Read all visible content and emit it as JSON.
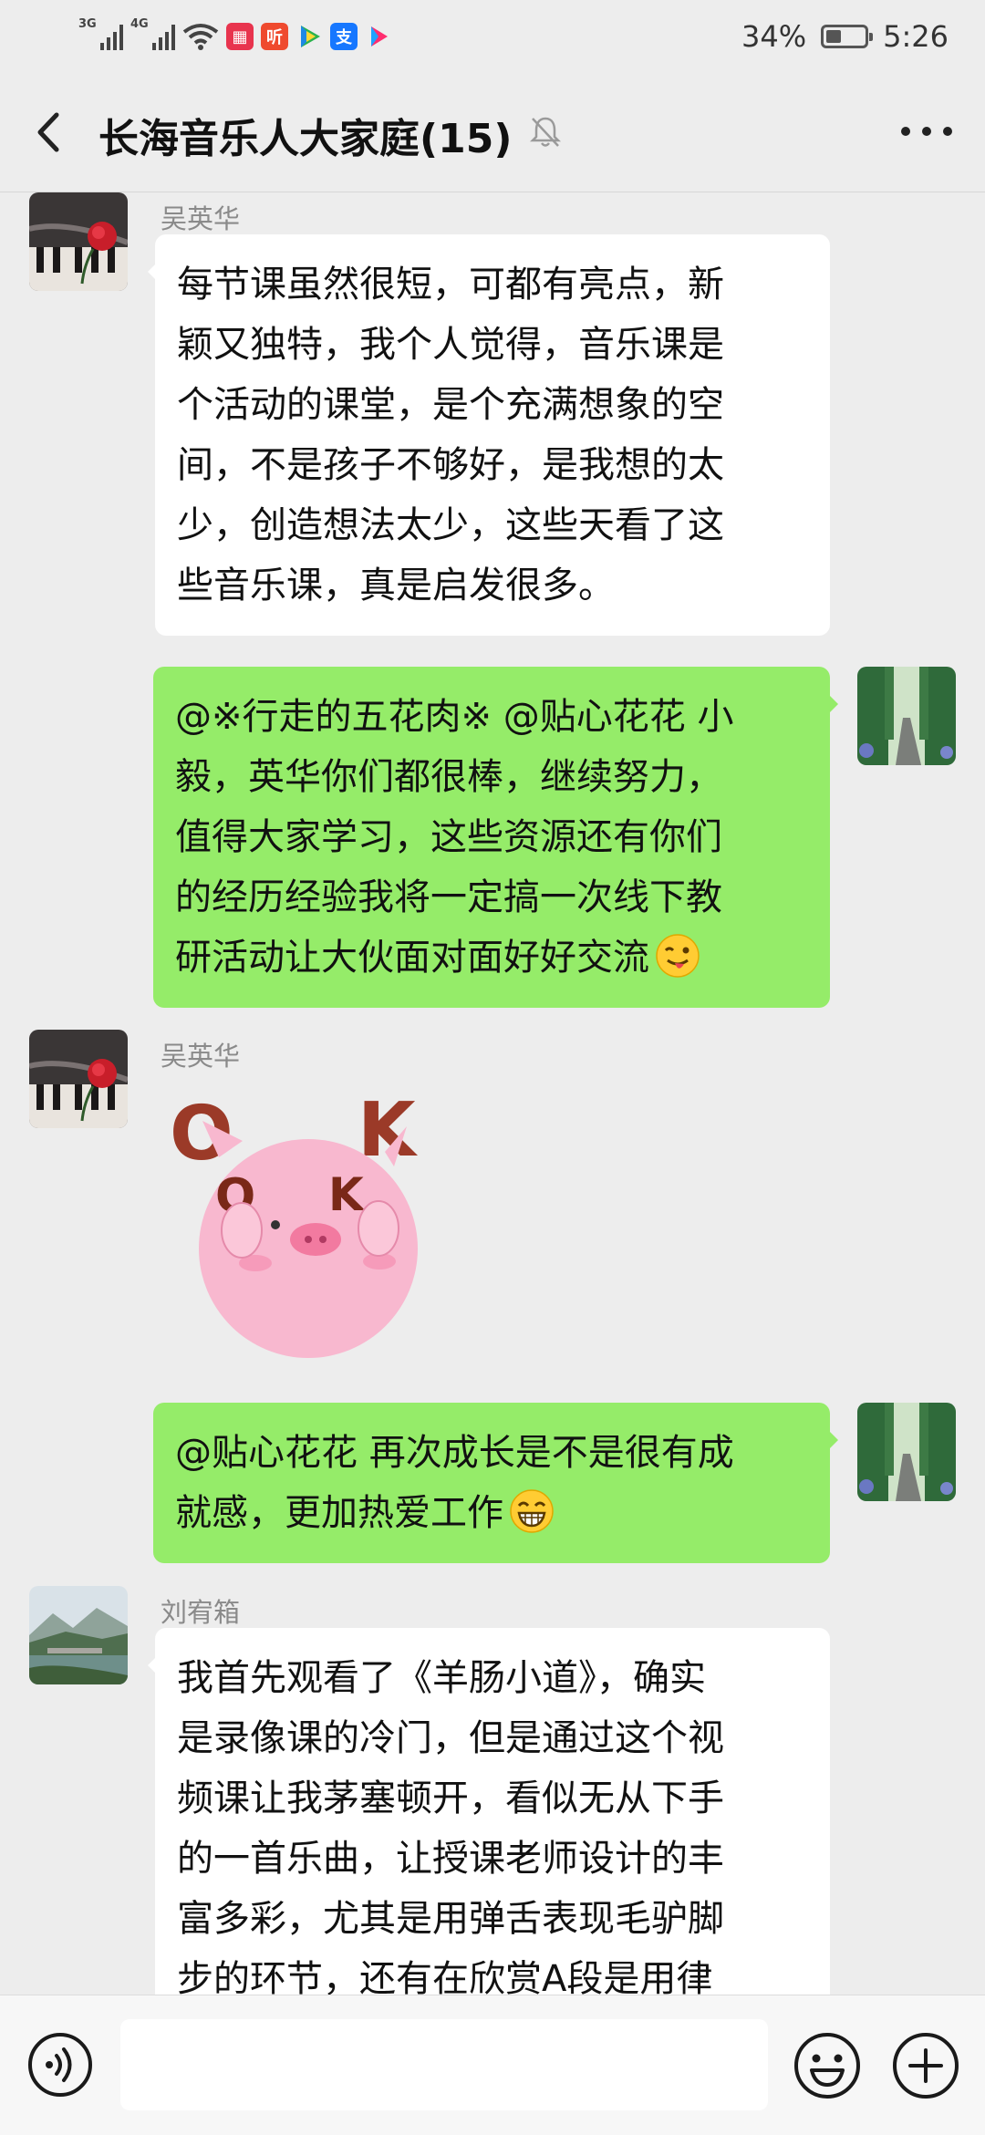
{
  "status_bar": {
    "net1": "3G",
    "net2": "4G",
    "battery": "34%",
    "time": "5:26",
    "app_icons": [
      "calendar-app-icon",
      "listen-app-icon",
      "video-app-icon",
      "alipay-icon",
      "youku-icon"
    ],
    "listen_glyph": "听",
    "alipay_glyph": "支"
  },
  "header": {
    "title": "长海音乐人大家庭(15)"
  },
  "messages": [
    {
      "side": "in",
      "sender": "吴英华",
      "avatar": "piano-rose-avatar",
      "lines": [
        "每节课虽然很短，可都有亮点，新",
        "颖又独特，我个人觉得，音乐课是",
        "个活动的课堂，是个充满想象的空",
        "间，不是孩子不够好，是我想的太",
        "少，创造想法太少，这些天看了这",
        "些音乐课，真是启发很多。"
      ]
    },
    {
      "side": "out",
      "avatar": "forest-road-avatar",
      "lines": [
        "@※行走的五花肉※ @贴心花花 小",
        "毅，英华你们都很棒，继续努力，",
        "值得大家学习，这些资源还有你们",
        "的经历经验我将一定搞一次线下教",
        "研活动让大伙面对面好好交流"
      ],
      "trailing_emoji": "wink-tongue-emoji"
    },
    {
      "side": "in",
      "sender": "吴英华",
      "avatar": "piano-rose-avatar",
      "sticker": {
        "name": "pink-pig-ok-sticker",
        "letters": [
          "O",
          "K",
          "O",
          "K"
        ]
      }
    },
    {
      "side": "out",
      "avatar": "forest-road-avatar",
      "lines": [
        "@贴心花花  再次成长是不是很有成",
        "就感，更加热爱工作"
      ],
      "trailing_emoji": "grin-emoji"
    },
    {
      "side": "in",
      "sender": "刘宥箱",
      "avatar": "river-mountain-avatar",
      "lines": [
        "我首先观看了《羊肠小道》，确实",
        "是录像课的冷门，但是通过这个视",
        "频课让我茅塞顿开，看似无从下手",
        "的一首乐曲，让授课老师设计的丰",
        "富多彩，尤其是用弹舌表现毛驴脚",
        "步的环节，还有在欣赏A段是用律"
      ]
    }
  ],
  "input_bar": {
    "placeholder": ""
  }
}
